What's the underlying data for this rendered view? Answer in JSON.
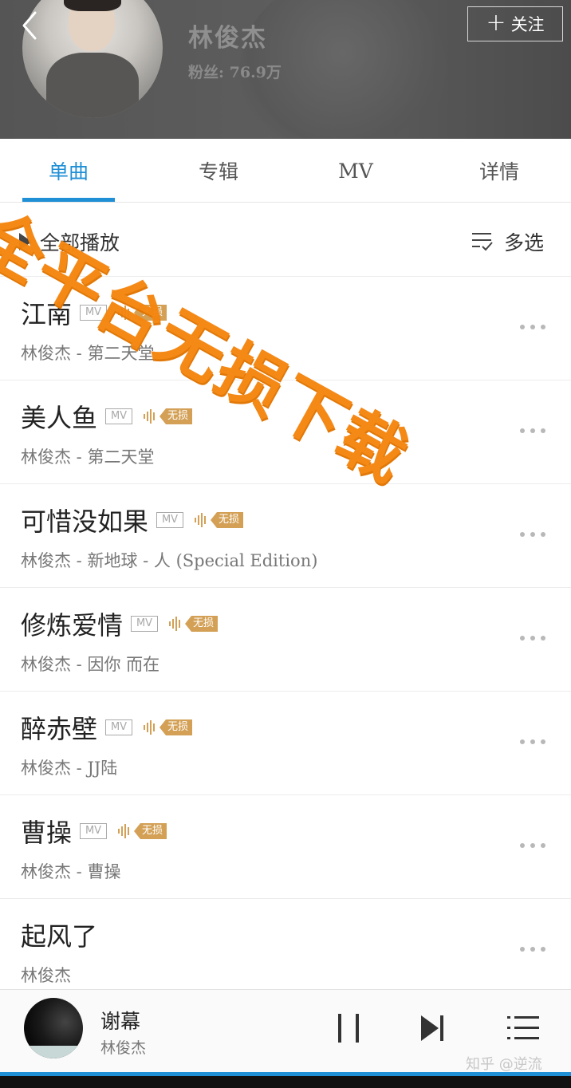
{
  "header": {
    "artist_name": "林俊杰",
    "fans_label": "粉丝: 76.9万",
    "follow_label": "关注",
    "follow_icon": "plus-icon",
    "back_icon": "chevron-left-icon"
  },
  "tabs": [
    {
      "label": "单曲",
      "active": true
    },
    {
      "label": "专辑",
      "active": false
    },
    {
      "label": "MV",
      "active": false
    },
    {
      "label": "详情",
      "active": false
    }
  ],
  "toolbar": {
    "play_all_label": "全部播放",
    "multi_select_label": "多选"
  },
  "songs": [
    {
      "title": "江南",
      "mv": "MV",
      "lossless": "无损",
      "subtitle": "林俊杰 - 第二天堂"
    },
    {
      "title": "美人鱼",
      "mv": "MV",
      "lossless": "无损",
      "subtitle": "林俊杰 - 第二天堂"
    },
    {
      "title": "可惜没如果",
      "mv": "MV",
      "lossless": "无损",
      "subtitle": "林俊杰 - 新地球 - 人 (Special Edition)"
    },
    {
      "title": "修炼爱情",
      "mv": "MV",
      "lossless": "无损",
      "subtitle": "林俊杰 - 因你 而在"
    },
    {
      "title": "醉赤壁",
      "mv": "MV",
      "lossless": "无损",
      "subtitle": "林俊杰 - JJ陆"
    },
    {
      "title": "曹操",
      "mv": "MV",
      "lossless": "无损",
      "subtitle": "林俊杰 - 曹操"
    },
    {
      "title": "起风了",
      "mv": "",
      "lossless": "",
      "subtitle": "林俊杰"
    }
  ],
  "watermark": "全平台无损下载",
  "player": {
    "title": "谢幕",
    "artist": "林俊杰"
  },
  "credit": "知乎 @逆流",
  "colors": {
    "accent": "#1f8fd6",
    "lossless_badge": "#d3a056",
    "watermark": "#f5860f"
  }
}
